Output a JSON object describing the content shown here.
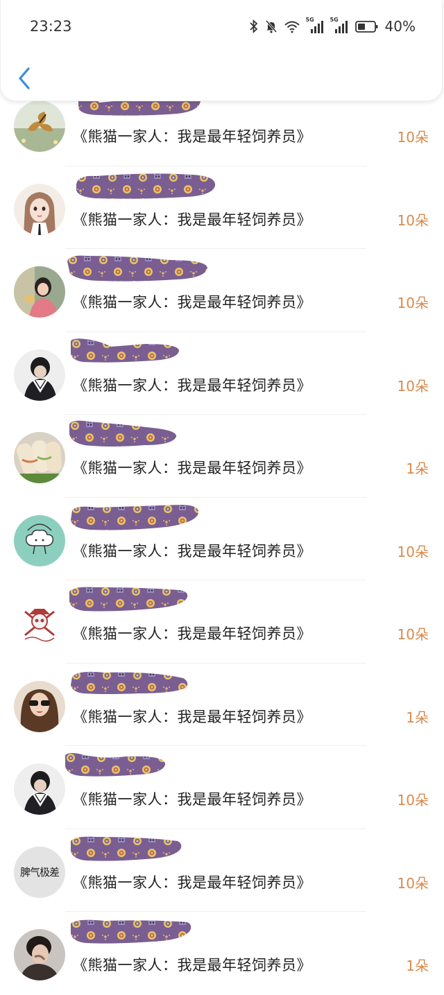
{
  "status_bar": {
    "time": "23:23",
    "battery": "40%",
    "network_tag": "5G"
  },
  "header": {
    "back_icon": "chevron-left-icon"
  },
  "colors": {
    "accent": "#d9894a",
    "back": "#3a8de0",
    "scribble_purple": "#7a5e91"
  },
  "rows": [
    {
      "title": "《熊猫一家人：我是最年轻饲养员》",
      "count": "10朵",
      "avatar": "butterfly"
    },
    {
      "title": "《熊猫一家人：我是最年轻饲养员》",
      "count": "10朵",
      "avatar": "anime-girl"
    },
    {
      "title": "《熊猫一家人：我是最年轻饲养员》",
      "count": "10朵",
      "avatar": "girl-photo"
    },
    {
      "title": "《熊猫一家人：我是最年轻饲养员》",
      "count": "10朵",
      "avatar": "boy-sweater"
    },
    {
      "title": "《熊猫一家人：我是最年轻饲养员》",
      "count": "1朵",
      "avatar": "spring-rolls"
    },
    {
      "title": "《熊猫一家人：我是最年轻饲养员》",
      "count": "10朵",
      "avatar": "cloud-cartoon"
    },
    {
      "title": "《熊猫一家人：我是最年轻饲养员》",
      "count": "10朵",
      "avatar": "skull-logo"
    },
    {
      "title": "《熊猫一家人：我是最年轻饲养员》",
      "count": "1朵",
      "avatar": "woman-sunglasses"
    },
    {
      "title": "《熊猫一家人：我是最年轻饲养员》",
      "count": "10朵",
      "avatar": "boy-sweater"
    },
    {
      "title": "《熊猫一家人：我是最年轻饲养员》",
      "count": "10朵",
      "avatar": "text-avatar",
      "avatar_text": "脾气极差"
    },
    {
      "title": "《熊猫一家人：我是最年轻饲养员》",
      "count": "1朵",
      "avatar": "boy-portrait"
    }
  ]
}
